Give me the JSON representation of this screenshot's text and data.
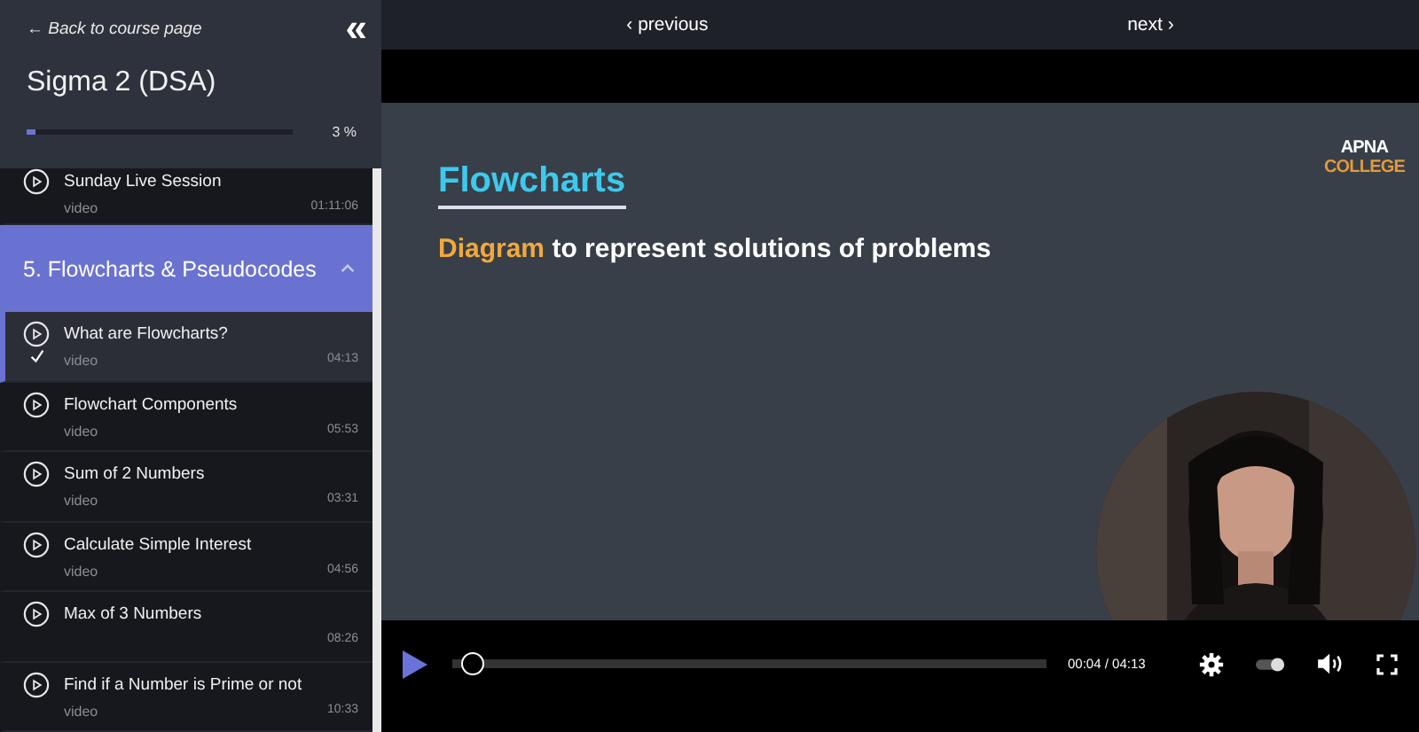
{
  "sidebar": {
    "back_link": "← Back to course page",
    "collapse_icon": "«",
    "course_title": "Sigma 2 (DSA)",
    "progress": {
      "level": 0.03,
      "reading": "3 %"
    },
    "items": [
      {
        "kind": "lesson",
        "title": "Sunday Live Session",
        "type": "video",
        "duration": "01:11:06",
        "selected": false,
        "completed": false
      },
      {
        "kind": "section",
        "title": "5. Flowcharts & Pseudocodes",
        "expanded": true
      },
      {
        "kind": "lesson",
        "title": "What are Flowcharts?",
        "type": "video",
        "duration": "04:13",
        "selected": true,
        "completed": true
      },
      {
        "kind": "lesson",
        "title": "Flowchart Components",
        "type": "video",
        "duration": "05:53",
        "selected": false,
        "completed": false
      },
      {
        "kind": "lesson",
        "title": "Sum of 2 Numbers",
        "type": "video",
        "duration": "03:31",
        "selected": false,
        "completed": false
      },
      {
        "kind": "lesson",
        "title": "Calculate Simple Interest",
        "type": "video",
        "duration": "04:56",
        "selected": false,
        "completed": false
      },
      {
        "kind": "lesson",
        "title": "Max of 3 Numbers",
        "duration": "08:26",
        "selected": false,
        "completed": false
      },
      {
        "kind": "lesson",
        "title": "Find if a Number is Prime or not",
        "type": "video",
        "duration": "10:33",
        "selected": false,
        "completed": false
      }
    ]
  },
  "nav": {
    "previous": "‹ previous",
    "next": "next ›"
  },
  "slide": {
    "logo_top": "APNA",
    "logo_bottom": "COLLEGE",
    "heading": "Flowcharts",
    "subtitle_highlight": "Diagram",
    "subtitle_rest": "to represent solutions of problems"
  },
  "player": {
    "playing": false,
    "level": 0.016,
    "time": "00:04 / 04:13"
  }
}
